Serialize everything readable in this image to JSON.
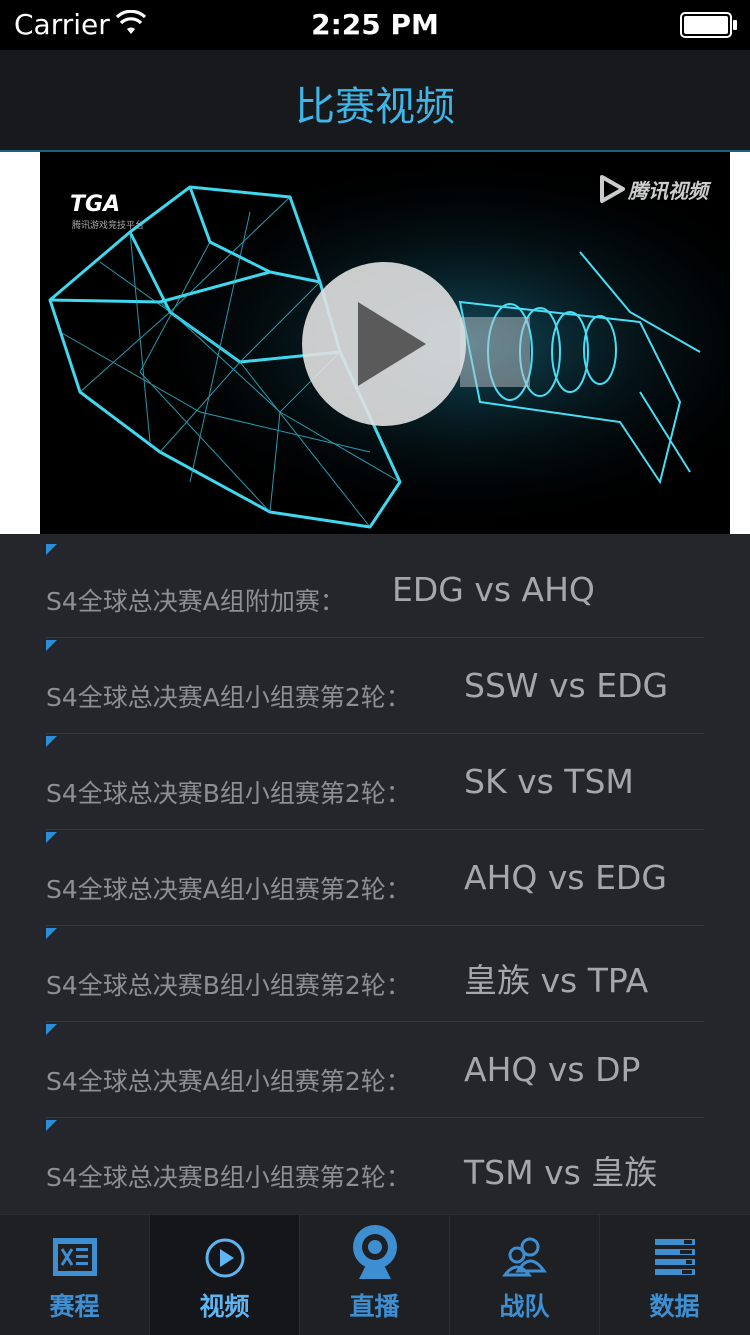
{
  "status_bar": {
    "carrier": "Carrier",
    "time": "2:25 PM"
  },
  "nav": {
    "title": "比赛视频"
  },
  "video": {
    "logo_left": "TGA",
    "logo_left_sub": "腾讯游戏竞技平台",
    "logo_right": "腾讯视频",
    "play_icon": "play-icon"
  },
  "videos": [
    {
      "prefix": "S4全球总决赛A组附加赛：",
      "match": "EDG vs AHQ"
    },
    {
      "prefix": "S4全球总决赛A组小组赛第2轮：",
      "match": "SSW vs EDG"
    },
    {
      "prefix": "S4全球总决赛B组小组赛第2轮：",
      "match": "SK vs TSM"
    },
    {
      "prefix": "S4全球总决赛A组小组赛第2轮：",
      "match": "AHQ vs EDG"
    },
    {
      "prefix": "S4全球总决赛B组小组赛第2轮：",
      "match": "皇族 vs TPA"
    },
    {
      "prefix": "S4全球总决赛A组小组赛第2轮：",
      "match": "AHQ vs DP"
    },
    {
      "prefix": "S4全球总决赛B组小组赛第2轮：",
      "match": "TSM vs 皇族"
    }
  ],
  "tabs": [
    {
      "label": "赛程",
      "icon": "schedule-icon"
    },
    {
      "label": "视频",
      "icon": "video-play-icon",
      "active": true
    },
    {
      "label": "直播",
      "icon": "webcam-icon"
    },
    {
      "label": "战队",
      "icon": "team-icon"
    },
    {
      "label": "数据",
      "icon": "data-icon"
    }
  ],
  "colors": {
    "accent": "#3fb6e8",
    "tab_label": "#3d8fd2",
    "background": "#25262b"
  }
}
